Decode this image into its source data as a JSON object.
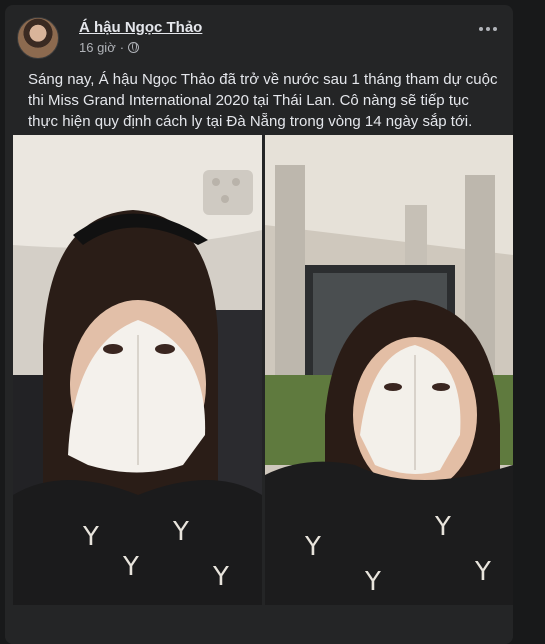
{
  "post": {
    "author": "Á hậu Ngọc Thảo",
    "time": "16 giờ",
    "audience_icon": "globe-icon",
    "more_icon": "more-horizontal-icon",
    "text": "Sáng nay, Á hậu Ngọc Thảo đã trở về nước sau 1 tháng tham dự cuộc thi Miss Grand International 2020 tại Thái Lan. Cô nàng sẽ tiếp tục thực hiện quy định cách ly tại Đà Nẵng trong vòng 14 ngày sắp tới.",
    "photos": [
      "airplane-selfie",
      "airport-selfie"
    ]
  },
  "colors": {
    "background": "#18191a",
    "card": "#242526",
    "primary_text": "#e4e6eb",
    "secondary_text": "#b0b3b8"
  }
}
